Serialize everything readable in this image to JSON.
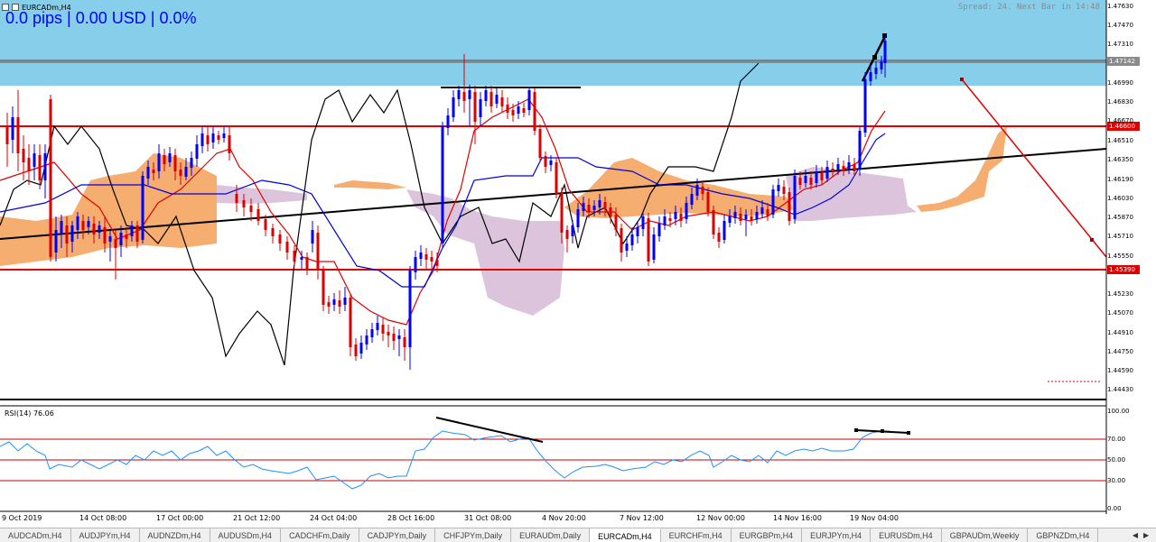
{
  "window": {
    "title": "EURCADm,H4"
  },
  "header": {
    "pips_readout": "0.0 pips | 0.00 USD | 0.0%",
    "spread_readout": "Spread: 24. Next Bar in 14:48"
  },
  "indicator": {
    "rsi_label": "RSI(14) 76.06"
  },
  "price_axis": {
    "labels": [
      "1.47630",
      "1.47470",
      "1.47310",
      "1.46990",
      "1.46830",
      "1.46670",
      "1.46510",
      "1.46350",
      "1.46190",
      "1.46030",
      "1.45870",
      "1.45710",
      "1.45550",
      "1.45230",
      "1.45070",
      "1.44910",
      "1.44750",
      "1.44590",
      "1.44430"
    ],
    "current_price": "1.47142",
    "level_high": "1.46600",
    "level_low": "1.45390"
  },
  "rsi_axis": {
    "labels": [
      "100.00",
      "70.00",
      "50.00",
      "30.00",
      "0.00"
    ]
  },
  "time_axis": {
    "labels": [
      "9 Oct 2019",
      "14 Oct 08:00",
      "17 Oct 00:00",
      "21 Oct 12:00",
      "24 Oct 04:00",
      "28 Oct 16:00",
      "31 Oct 08:00",
      "4 Nov 20:00",
      "7 Nov 12:00",
      "12 Nov 00:00",
      "14 Nov 16:00",
      "19 Nov 04:00"
    ]
  },
  "tabs": [
    {
      "label": "AUDCADm,H4",
      "active": false
    },
    {
      "label": "AUDJPYm,H4",
      "active": false
    },
    {
      "label": "AUDNZDm,H4",
      "active": false
    },
    {
      "label": "AUDUSDm,H4",
      "active": false
    },
    {
      "label": "CADCHFm,Daily",
      "active": false
    },
    {
      "label": "CADJPYm,Daily",
      "active": false
    },
    {
      "label": "CHFJPYm,Daily",
      "active": false
    },
    {
      "label": "EURAUDm,Daily",
      "active": false
    },
    {
      "label": "EURCADm,H4",
      "active": true
    },
    {
      "label": "EURCHFm,H4",
      "active": false
    },
    {
      "label": "EURGBPm,H4",
      "active": false
    },
    {
      "label": "EURJPYm,H4",
      "active": false
    },
    {
      "label": "EURUSDm,H4",
      "active": false
    },
    {
      "label": "GBPAUDm,Weekly",
      "active": false
    },
    {
      "label": "GBPNZDm,H4",
      "active": false
    }
  ],
  "colors": {
    "zone_fill": "#87ceeb",
    "level_line": "#e00000",
    "bull_candle": "#0000ff",
    "bear_candle": "#e00000",
    "kumo_bull": "#f4a460",
    "kumo_bear": "#d8bfd8",
    "rsi_line": "#1e90ff"
  }
}
